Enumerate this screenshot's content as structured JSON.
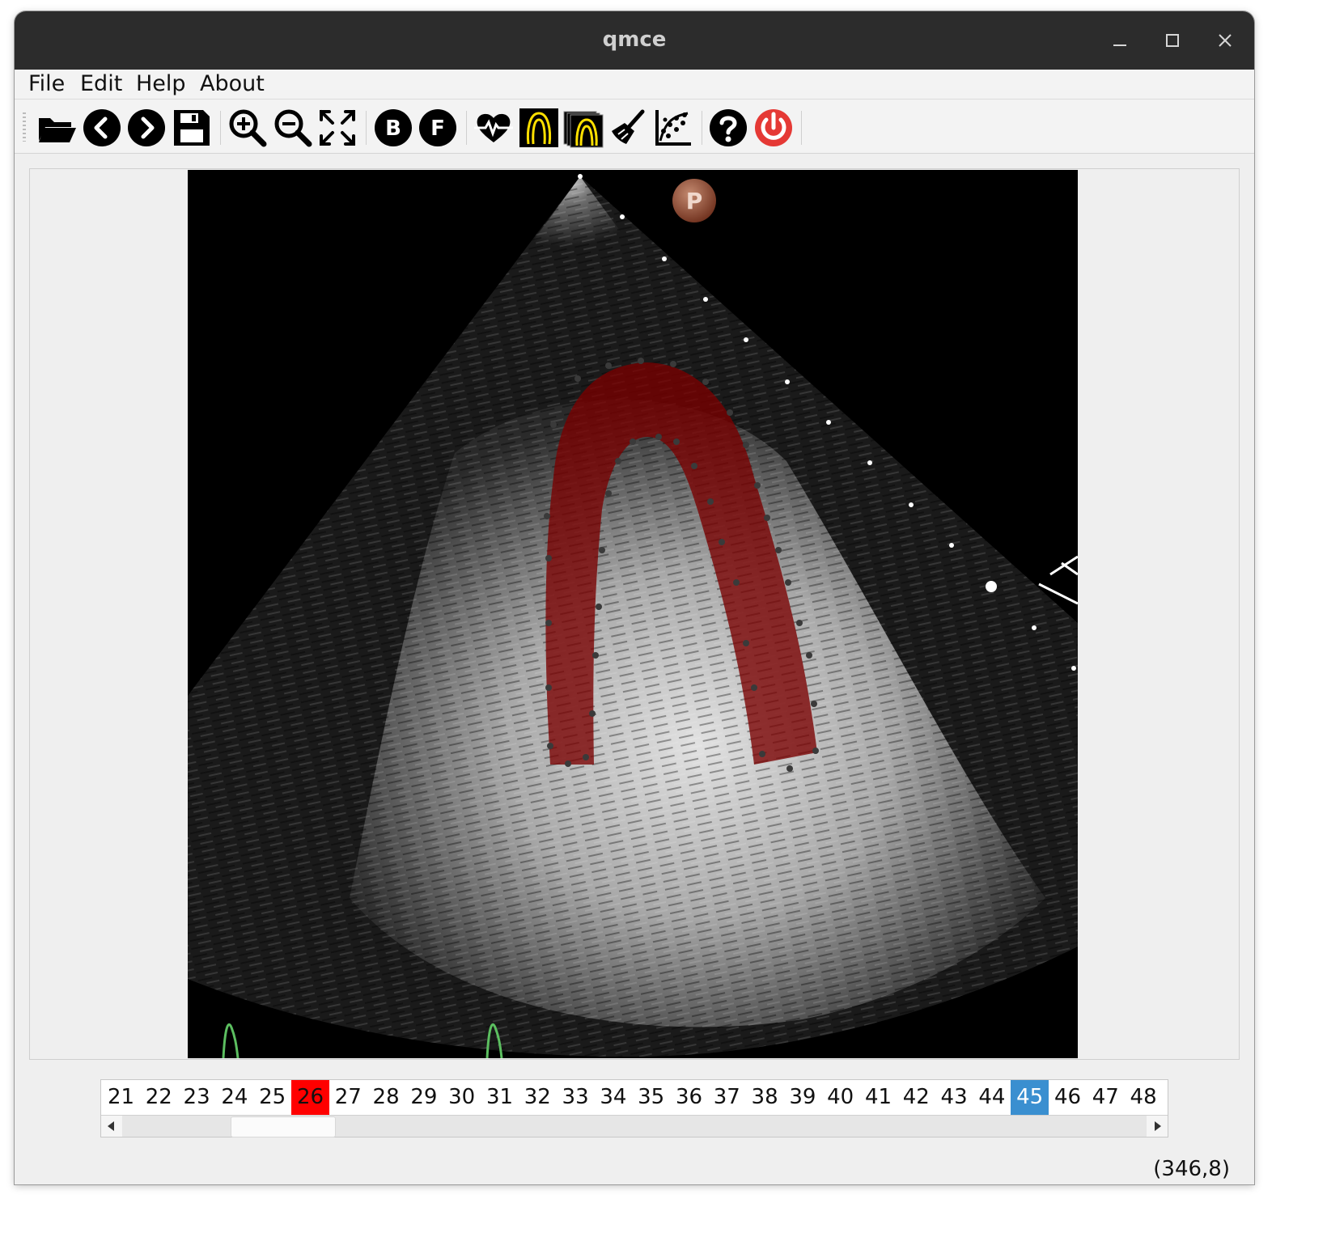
{
  "window": {
    "title": "qmce"
  },
  "menu": {
    "items": [
      "File",
      "Edit",
      "Help",
      "About"
    ]
  },
  "toolbar": {
    "tools": [
      "open-folder-icon",
      "previous-icon",
      "next-icon",
      "save-icon",
      "zoom-in-icon",
      "zoom-out-icon",
      "fit-view-icon",
      "baseline-b-icon",
      "frame-f-icon",
      "heart-ecg-icon",
      "myocardium-contour-icon",
      "contour-stack-icon",
      "clear-brush-icon",
      "perfusion-plot-icon",
      "help-icon",
      "power-icon"
    ],
    "baseline_label": "B",
    "frame_label": "F"
  },
  "image": {
    "marker_label": "P"
  },
  "frames": {
    "list": [
      "21",
      "22",
      "23",
      "24",
      "25",
      "26",
      "27",
      "28",
      "29",
      "30",
      "31",
      "32",
      "33",
      "34",
      "35",
      "36",
      "37",
      "38",
      "39",
      "40",
      "41",
      "42",
      "43",
      "44",
      "45",
      "46",
      "47",
      "48"
    ],
    "current": "26",
    "selected": "45"
  },
  "status": {
    "coords": "(346,8)"
  },
  "colors": {
    "current_frame": "#ff0000",
    "selected_frame": "#3a8fd0",
    "myocardium_overlay": "#7a0000",
    "ecg_trigger": "#4caf50",
    "power_icon": "#e53935"
  }
}
